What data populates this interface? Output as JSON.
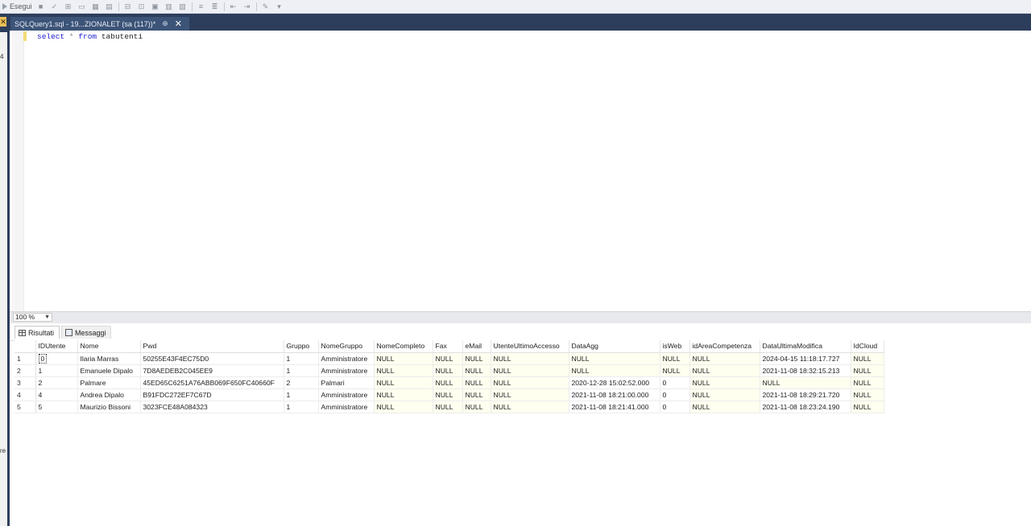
{
  "toolbar": {
    "run_label": "Esegui"
  },
  "left": {
    "glyphs": [
      "4",
      "re"
    ]
  },
  "document_tab": {
    "title": "SQLQuery1.sql - 19...ZIONALET (sa (117))*",
    "pin": "⊕",
    "close": "✕"
  },
  "editor": {
    "keyword1": "select",
    "star": "*",
    "keyword2": "from",
    "table": "tabutenti"
  },
  "zoom": {
    "value": "100 %"
  },
  "results_tabs": {
    "results": "Risultati",
    "messages": "Messaggi"
  },
  "grid": {
    "columns": [
      "IDUtente",
      "Nome",
      "Pwd",
      "Gruppo",
      "NomeGruppo",
      "NomeCompleto",
      "Fax",
      "eMail",
      "UtenteUltimoAccesso",
      "DataAgg",
      "isWeb",
      "idAreaCompetenza",
      "DataUltimaModifica",
      "IdCloud"
    ],
    "rows": [
      [
        "1",
        "0",
        "Ilaria Marras",
        "50255E43F4EC75D0",
        "1",
        "Amministratore",
        "NULL",
        "NULL",
        "NULL",
        "NULL",
        "NULL",
        "NULL",
        "NULL",
        "2024-04-15 11:18:17.727",
        "NULL"
      ],
      [
        "2",
        "1",
        "Emanuele Dipalo",
        "7D8AEDEB2C045EE9",
        "1",
        "Amministratore",
        "NULL",
        "NULL",
        "NULL",
        "NULL",
        "NULL",
        "NULL",
        "NULL",
        "2021-11-08 18:32:15.213",
        "NULL"
      ],
      [
        "3",
        "2",
        "Palmare",
        "45ED65C6251A76ABB069F650FC40660F",
        "2",
        "Palmari",
        "NULL",
        "NULL",
        "NULL",
        "NULL",
        "2020-12-28 15:02:52.000",
        "0",
        "NULL",
        "NULL",
        "NULL"
      ],
      [
        "4",
        "4",
        "Andrea Dipalo",
        "B91FDC272EF7C67D",
        "1",
        "Amministratore",
        "NULL",
        "NULL",
        "NULL",
        "NULL",
        "2021-11-08 18:21:00.000",
        "0",
        "NULL",
        "2021-11-08 18:29:21.720",
        "NULL"
      ],
      [
        "5",
        "5",
        "Maurizio Bissoni",
        "3023FCE48A084323",
        "1",
        "Amministratore",
        "NULL",
        "NULL",
        "NULL",
        "NULL",
        "2021-11-08 18:21:41.000",
        "0",
        "NULL",
        "2021-11-08 18:23:24.190",
        "NULL"
      ]
    ]
  }
}
